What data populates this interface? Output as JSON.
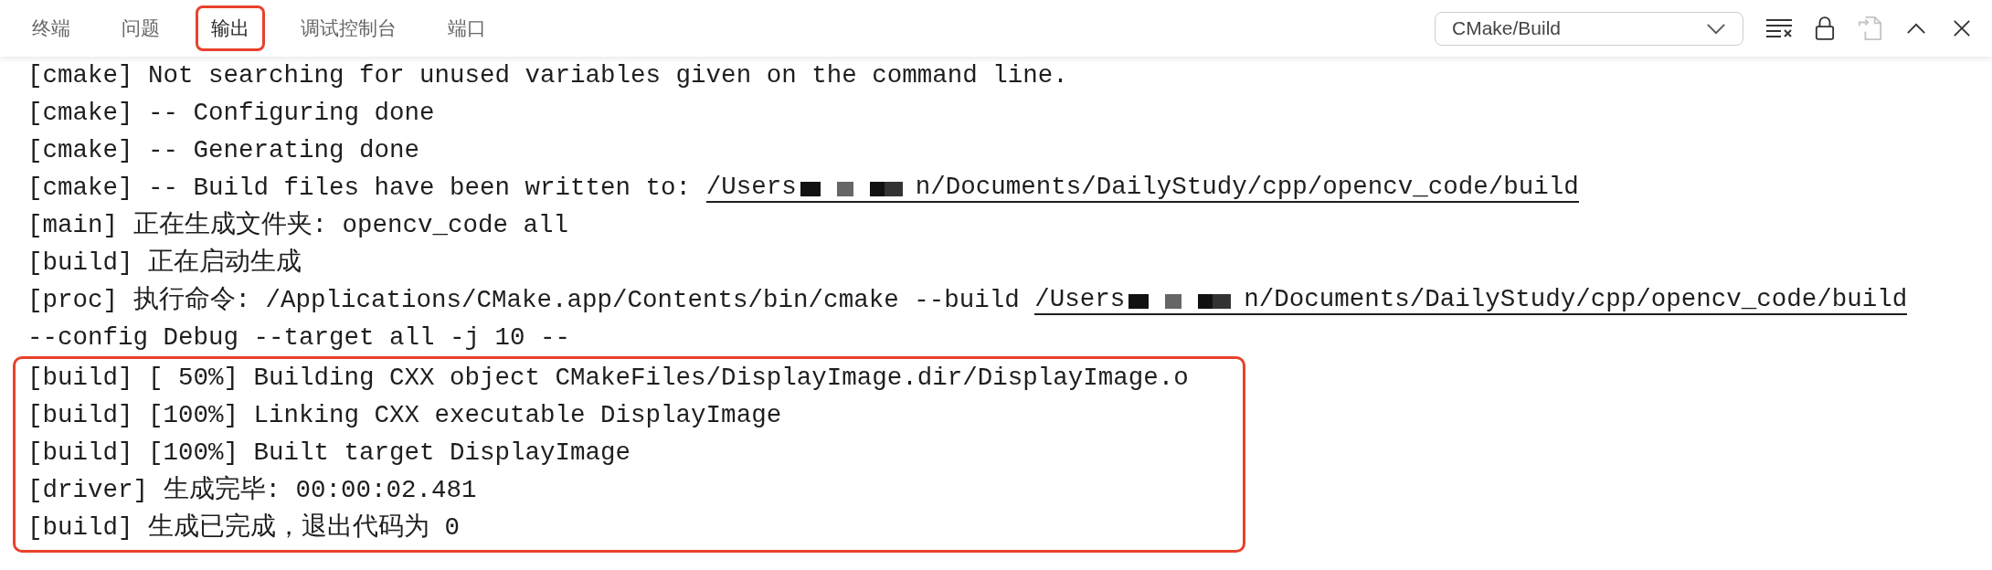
{
  "tabs": [
    {
      "label": "终端",
      "selected": false
    },
    {
      "label": "问题",
      "selected": false
    },
    {
      "label": "输出",
      "selected": true
    },
    {
      "label": "调试控制台",
      "selected": false
    },
    {
      "label": "端口",
      "selected": false
    }
  ],
  "output_selector": {
    "value": "CMake/Build"
  },
  "toolbar_buttons": [
    {
      "kind": "clear",
      "disabled": false
    },
    {
      "kind": "lock",
      "disabled": false
    },
    {
      "kind": "copy",
      "disabled": true
    },
    {
      "kind": "maximize",
      "disabled": false
    },
    {
      "kind": "close",
      "disabled": false
    }
  ],
  "lines": [
    {
      "text": "[cmake] Not searching for unused variables given on the command line."
    },
    {
      "text": "[cmake] -- Configuring done"
    },
    {
      "text": "[cmake] -- Generating done"
    },
    {
      "text": "[cmake] -- Build files have been written to: ",
      "link_prefix": "/Users",
      "link_suffix": "n/Documents/DailyStudy/cpp/opencv_code/build"
    },
    {
      "text": "[main] 正在生成文件夹: opencv_code all"
    },
    {
      "text": "[build] 正在启动生成"
    },
    {
      "text": "[proc] 执行命令: /Applications/CMake.app/Contents/bin/cmake --build ",
      "link_prefix": "/Users",
      "link_suffix": "n/Documents/DailyStudy/cpp/opencv_code/build"
    },
    {
      "text": "--config Debug --target all -j 10 --"
    }
  ],
  "highlighted_lines": [
    {
      "text": "[build] [ 50%] Building CXX object CMakeFiles/DisplayImage.dir/DisplayImage.o"
    },
    {
      "text": "[build] [100%] Linking CXX executable DisplayImage"
    },
    {
      "text": "[build] [100%] Built target DisplayImage"
    },
    {
      "text": "[driver] 生成完毕: 00:00:02.481"
    },
    {
      "text": "[build] 生成已完成，退出代码为 0"
    }
  ]
}
